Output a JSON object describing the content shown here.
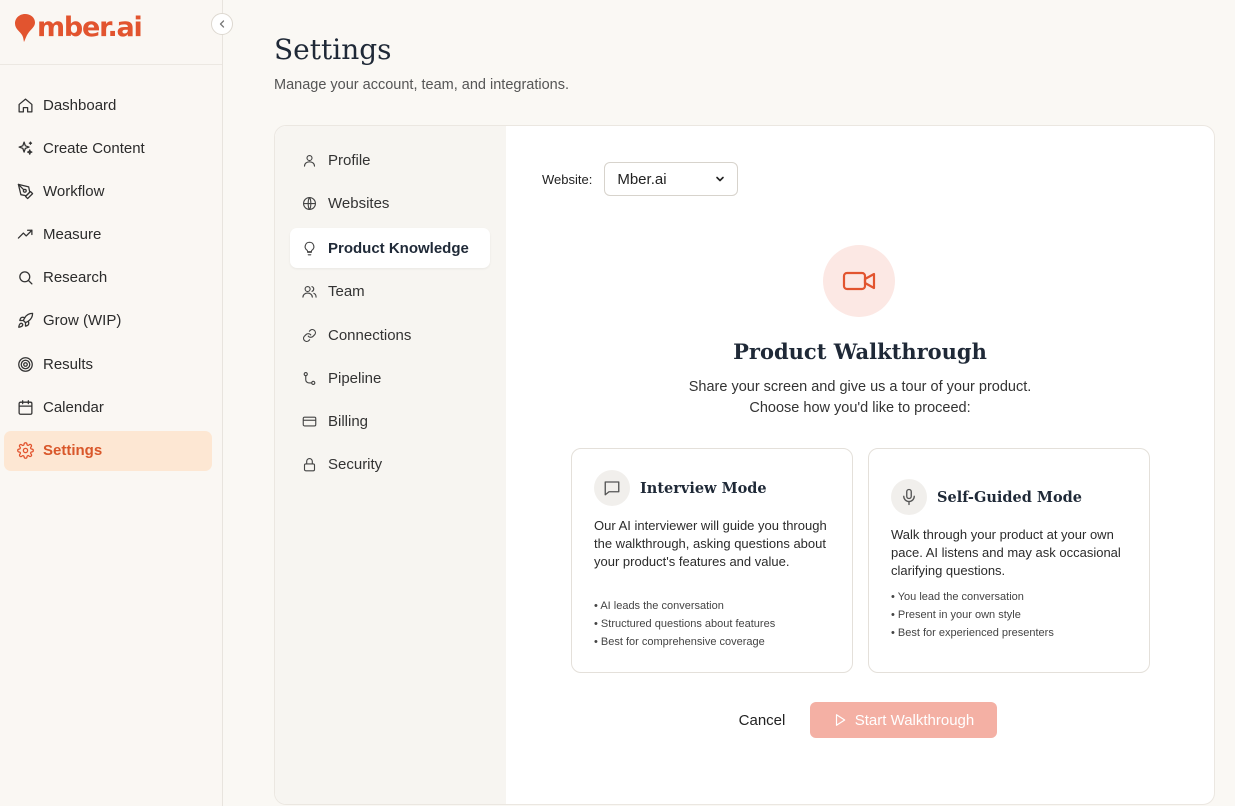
{
  "app": {
    "brand": "mber.ai",
    "accent_color": "#e2542f"
  },
  "sidebar": {
    "collapse_icon": "chevron-left-icon",
    "items": [
      {
        "label": "Dashboard",
        "icon": "home-icon",
        "active": false
      },
      {
        "label": "Create Content",
        "icon": "sparkles-icon",
        "active": false
      },
      {
        "label": "Workflow",
        "icon": "pen-tool-icon",
        "active": false
      },
      {
        "label": "Measure",
        "icon": "trending-up-icon",
        "active": false
      },
      {
        "label": "Research",
        "icon": "search-icon",
        "active": false
      },
      {
        "label": "Grow (WIP)",
        "icon": "rocket-icon",
        "active": false
      },
      {
        "label": "Results",
        "icon": "target-icon",
        "active": false
      },
      {
        "label": "Calendar",
        "icon": "calendar-icon",
        "active": false
      },
      {
        "label": "Settings",
        "icon": "gear-icon",
        "active": true
      }
    ]
  },
  "header": {
    "title": "Settings",
    "subtitle": "Manage your account, team, and integrations."
  },
  "settings_nav": {
    "items": [
      {
        "label": "Profile",
        "icon": "user-icon",
        "active": false
      },
      {
        "label": "Websites",
        "icon": "globe-icon",
        "active": false
      },
      {
        "label": "Product Knowledge",
        "icon": "lightbulb-icon",
        "active": true
      },
      {
        "label": "Team",
        "icon": "users-icon",
        "active": false
      },
      {
        "label": "Connections",
        "icon": "link-icon",
        "active": false
      },
      {
        "label": "Pipeline",
        "icon": "git-branch-icon",
        "active": false
      },
      {
        "label": "Billing",
        "icon": "credit-card-icon",
        "active": false
      },
      {
        "label": "Security",
        "icon": "lock-icon",
        "active": false
      }
    ]
  },
  "content": {
    "website_label": "Website:",
    "website_value": "Mber.ai",
    "hero_icon": "video-camera-icon",
    "title": "Product Walkthrough",
    "description_line1": "Share your screen and give us a tour of your product.",
    "description_line2": "Choose how you'd like to proceed:",
    "modes": [
      {
        "title": "Interview Mode",
        "icon": "message-square-icon",
        "description": "Our AI interviewer will guide you through the walkthrough, asking questions about your product's features and value.",
        "bullets": [
          "AI leads the conversation",
          "Structured questions about features",
          "Best for comprehensive coverage"
        ]
      },
      {
        "title": "Self-Guided Mode",
        "icon": "microphone-icon",
        "description": "Walk through your product at your own pace. AI listens and may ask occasional clarifying questions.",
        "bullets": [
          "You lead the conversation",
          "Present in your own style",
          "Best for experienced presenters"
        ]
      }
    ],
    "cancel_label": "Cancel",
    "start_label": "Start Walkthrough",
    "start_button_color": "#f4b0a4"
  }
}
